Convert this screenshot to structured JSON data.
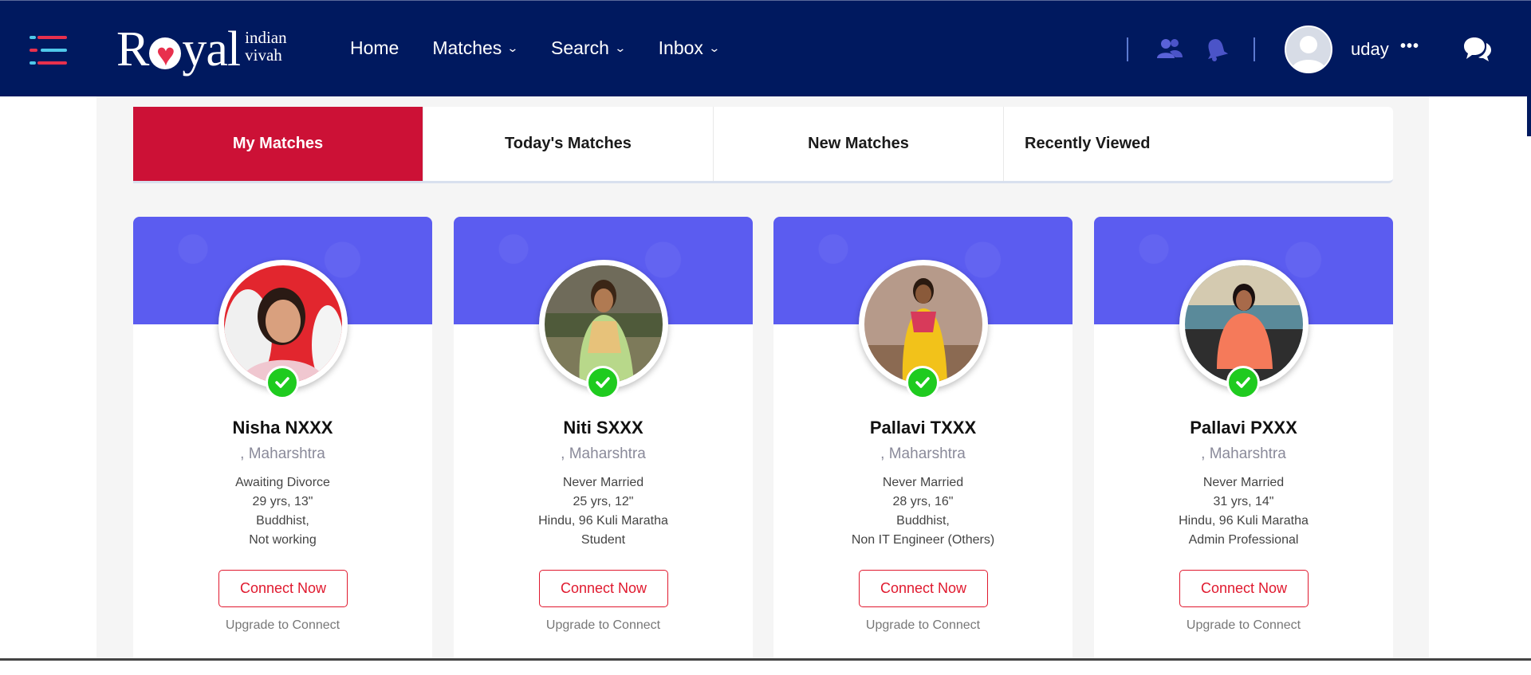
{
  "header": {
    "logo": {
      "brand": "Royal",
      "sub_line1": "indian",
      "sub_line2": "vivah"
    },
    "nav": [
      {
        "label": "Home",
        "has_dropdown": false
      },
      {
        "label": "Matches",
        "has_dropdown": true
      },
      {
        "label": "Search",
        "has_dropdown": true
      },
      {
        "label": "Inbox",
        "has_dropdown": true
      }
    ],
    "icons": [
      "menu-icon",
      "connections-icon",
      "notification-bell-icon",
      "avatar",
      "more-dots-icon",
      "chat-icon"
    ],
    "user": {
      "name": "uday",
      "more": "•••"
    }
  },
  "tabs": [
    {
      "label": "My Matches",
      "active": true
    },
    {
      "label": "Today's Matches",
      "active": false
    },
    {
      "label": "New Matches",
      "active": false
    },
    {
      "label": "Recently Viewed",
      "active": false
    }
  ],
  "profiles": [
    {
      "name": "Nisha NXXX",
      "location": ", Maharshtra",
      "marital": "Awaiting Divorce",
      "age_height": "29 yrs, 13\"",
      "religion": "Buddhist,",
      "occupation": "Not working",
      "connect": "Connect Now",
      "upgrade": "Upgrade to Connect"
    },
    {
      "name": "Niti SXXX",
      "location": ", Maharshtra",
      "marital": "Never Married",
      "age_height": "25 yrs, 12\"",
      "religion": "Hindu, 96 Kuli Maratha",
      "occupation": "Student",
      "connect": "Connect Now",
      "upgrade": "Upgrade to Connect"
    },
    {
      "name": "Pallavi TXXX",
      "location": ", Maharshtra",
      "marital": "Never Married",
      "age_height": "28 yrs, 16\"",
      "religion": "Buddhist,",
      "occupation": "Non IT Engineer (Others)",
      "connect": "Connect Now",
      "upgrade": "Upgrade to Connect"
    },
    {
      "name": "Pallavi PXXX",
      "location": ", Maharshtra",
      "marital": "Never Married",
      "age_height": "31 yrs, 14\"",
      "religion": "Hindu, 96 Kuli Maratha",
      "occupation": "Admin Professional",
      "connect": "Connect Now",
      "upgrade": "Upgrade to Connect"
    }
  ],
  "colors": {
    "header_bg": "#00195f",
    "active_tab": "#cc1136",
    "card_band": "#5b5cf0",
    "verified": "#1fcb1f",
    "connect": "#e0192e"
  }
}
